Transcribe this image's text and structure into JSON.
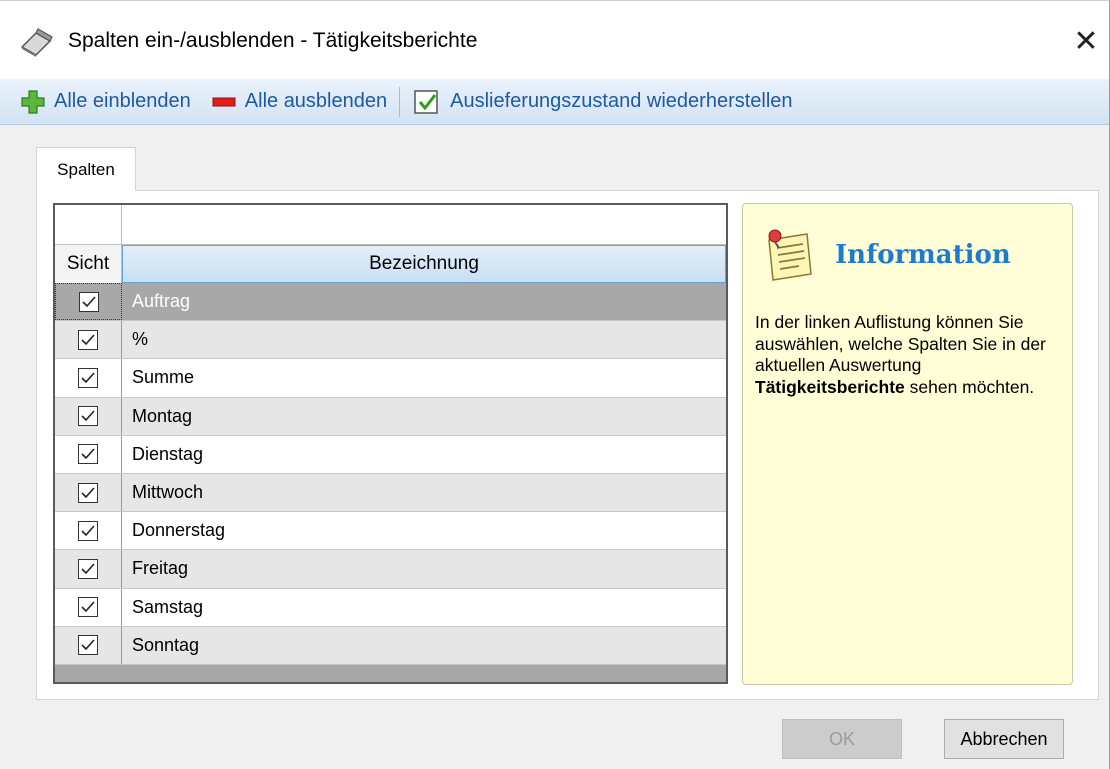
{
  "window": {
    "title": "Spalten ein-/ausblenden - Tätigkeitsberichte",
    "close_label": "✕"
  },
  "toolbar": {
    "show_all": "Alle einblenden",
    "hide_all": "Alle ausblenden",
    "restore": "Auslieferungszustand wiederherstellen"
  },
  "tab": {
    "label": "Spalten"
  },
  "grid": {
    "columns": [
      "Sicht",
      "Bezeichnung"
    ],
    "rows": [
      {
        "name": "Auftrag",
        "checked": true,
        "selected": true
      },
      {
        "name": "%",
        "checked": true
      },
      {
        "name": "Summe",
        "checked": true
      },
      {
        "name": "Montag",
        "checked": true
      },
      {
        "name": "Dienstag",
        "checked": true
      },
      {
        "name": "Mittwoch",
        "checked": true
      },
      {
        "name": "Donnerstag",
        "checked": true
      },
      {
        "name": "Freitag",
        "checked": true
      },
      {
        "name": "Samstag",
        "checked": true
      },
      {
        "name": "Sonntag",
        "checked": true
      }
    ]
  },
  "info": {
    "title": "Information",
    "text_before": "In der linken Auflistung können Sie auswählen, welche Spalten Sie in der aktuellen Auswertung ",
    "text_bold": "Tätigkeitsberichte",
    "text_after": " sehen möchten."
  },
  "buttons": {
    "ok": "OK",
    "cancel": "Abbrechen"
  },
  "colors": {
    "accent": "#1f7bd1",
    "toolbar_text": "#1d5aa3",
    "info_bg": "#fffed6"
  }
}
